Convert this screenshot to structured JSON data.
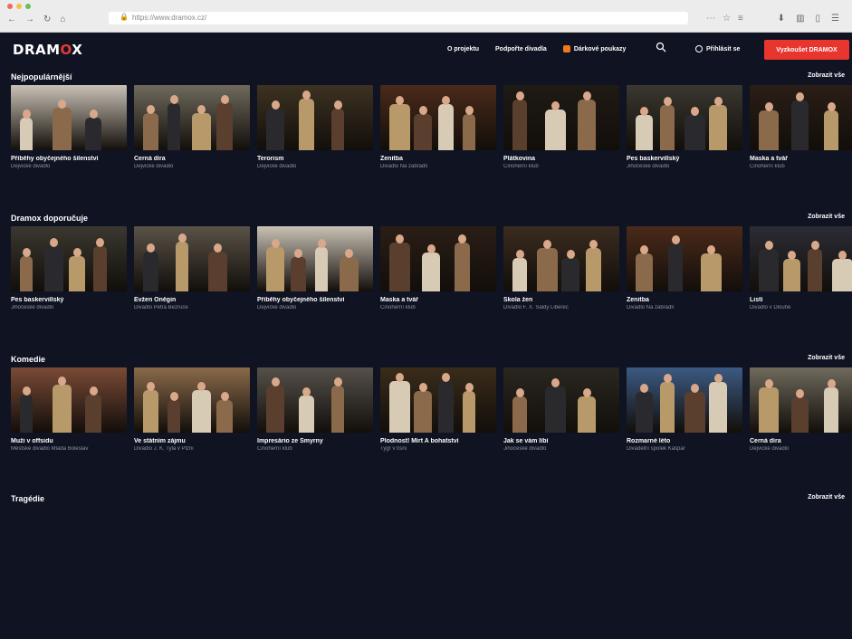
{
  "browser": {
    "url": "https://www.dramox.cz/",
    "lock_icon": "lock-icon",
    "traffic_colors": [
      "#ed6a5e",
      "#f4bf4f",
      "#61c554"
    ]
  },
  "header": {
    "logo_prefix": "DRAM",
    "logo_accent": "O",
    "logo_suffix": "X",
    "nav": [
      "O projektu",
      "Podpořte divadla",
      "Dárkové poukazy"
    ],
    "login": "Přihlásit se",
    "cta": "Vyzkoušet DRAMOX",
    "accent_color": "#e8362f"
  },
  "sections": [
    {
      "title": "Nejpopulárnější",
      "more": "Zobrazit vše",
      "cards": [
        {
          "title": "Příběhy obyčejného šílenství",
          "sub": "Dejvické divadlo",
          "bg": "#c9c1b5"
        },
        {
          "title": "Černá díra",
          "sub": "Dejvické divadlo",
          "bg": "#6f6a5c"
        },
        {
          "title": "Terorism",
          "sub": "Dejvické divadlo",
          "bg": "#3d3222"
        },
        {
          "title": "Ženitba",
          "sub": "Divadlo Na zábradlí",
          "bg": "#4a2a1a"
        },
        {
          "title": "Plátkovina",
          "sub": "Činoherní klub",
          "bg": "#1f1a14"
        },
        {
          "title": "Pes baskervillský",
          "sub": "Jihočeské divadlo",
          "bg": "#3a3830"
        },
        {
          "title": "Maska a tvář",
          "sub": "Činoherní klub",
          "bg": "#2a1e16"
        }
      ]
    },
    {
      "title": "Dramox doporučuje",
      "more": "Zobrazit vše",
      "cards": [
        {
          "title": "Pes baskervillský",
          "sub": "Jihočeské divadlo",
          "bg": "#3a3830"
        },
        {
          "title": "Evžen Oněgin",
          "sub": "Divadlo Petra Bezruče",
          "bg": "#5a5248"
        },
        {
          "title": "Příběhy obyčejného šílenství",
          "sub": "Dejvické divadlo",
          "bg": "#c9c1b5"
        },
        {
          "title": "Maska a tvář",
          "sub": "Činoherní klub",
          "bg": "#2a1e16"
        },
        {
          "title": "Škola žen",
          "sub": "Divadlo F. X. Šaldy Liberec",
          "bg": "#3b2c20"
        },
        {
          "title": "Ženitba",
          "sub": "Divadlo Na zábradlí",
          "bg": "#4a2a1a"
        },
        {
          "title": "Listí",
          "sub": "Divadlo v Dlouhé",
          "bg": "#2b2d35"
        }
      ]
    },
    {
      "title": "Komedie",
      "more": "Zobrazit vše",
      "cards": [
        {
          "title": "Muži v offsidu",
          "sub": "Městské divadlo Mladá Boleslav",
          "bg": "#7a4a36"
        },
        {
          "title": "Ve státním zájmu",
          "sub": "Divadlo J. K. Tyla v Plzni",
          "bg": "#8a6a4a"
        },
        {
          "title": "Impresário ze Smyrny",
          "sub": "Činoherní klub",
          "bg": "#55504a"
        },
        {
          "title": "Plodnost! Mírt A bohatství",
          "sub": "Tygr v tísni",
          "bg": "#3a2c1a"
        },
        {
          "title": "Jak se vám líbí",
          "sub": "Jihočeské divadlo",
          "bg": "#2a2620"
        },
        {
          "title": "Rozmarné léto",
          "sub": "Divadelní spolek Kašpar",
          "bg": "#3c5a82"
        },
        {
          "title": "Černá díra",
          "sub": "Dejvické divadlo",
          "bg": "#6f6a5c"
        }
      ]
    },
    {
      "title": "Tragédie",
      "more": "Zobrazit vše",
      "cards": []
    }
  ]
}
